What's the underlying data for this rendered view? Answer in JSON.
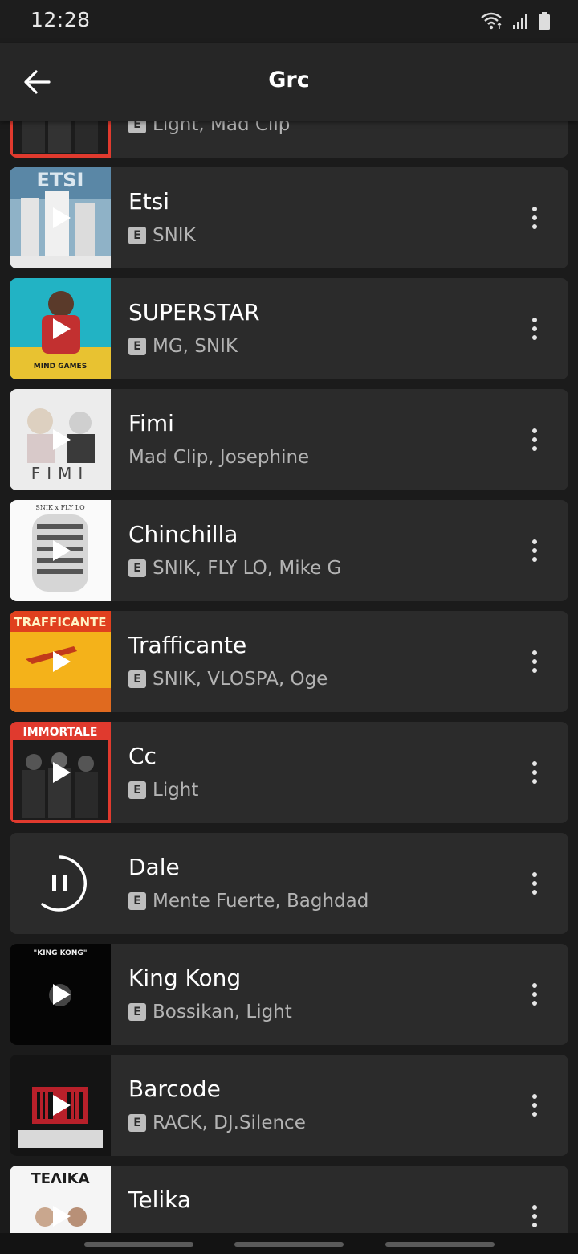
{
  "status_bar": {
    "time": "12:28",
    "icons": [
      "wifi-icon",
      "signal-icon",
      "battery-icon"
    ]
  },
  "header": {
    "title": "Grc",
    "back_icon": "arrow-left-icon"
  },
  "tracks": [
    {
      "title": "",
      "artists": "Light, Mad Clip",
      "explicit": true,
      "art": "immortale",
      "state": "play"
    },
    {
      "title": "Etsi",
      "artists": "SNIK",
      "explicit": true,
      "art": "etsi",
      "state": "play"
    },
    {
      "title": "SUPERSTAR",
      "artists": "MG, SNIK",
      "explicit": true,
      "art": "superstar",
      "state": "play"
    },
    {
      "title": "Fimi",
      "artists": "Mad Clip, Josephine",
      "explicit": false,
      "art": "fimi",
      "state": "play"
    },
    {
      "title": "Chinchilla",
      "artists": "SNIK, FLY LO, Mike G",
      "explicit": true,
      "art": "chinchilla",
      "state": "play"
    },
    {
      "title": "Trafficante",
      "artists": "SNIK, VLOSPA, Oge",
      "explicit": true,
      "art": "trafficante",
      "state": "play"
    },
    {
      "title": "Cc",
      "artists": "Light",
      "explicit": true,
      "art": "immortale",
      "state": "play"
    },
    {
      "title": "Dale",
      "artists": "Mente Fuerte, Baghdad",
      "explicit": true,
      "art": "none",
      "state": "pause"
    },
    {
      "title": "King Kong",
      "artists": "Bossikan, Light",
      "explicit": true,
      "art": "kingkong",
      "state": "play"
    },
    {
      "title": "Barcode",
      "artists": "RACK, DJ.Silence",
      "explicit": true,
      "art": "barcode",
      "state": "play"
    },
    {
      "title": "Telika",
      "artists": "",
      "explicit": false,
      "art": "telika",
      "state": "play"
    }
  ],
  "album_art_text": {
    "etsi": "ETSI",
    "superstar": "MIND GAMES",
    "fimi": "FIMI",
    "chinchilla": "SNIK x FLY LO",
    "trafficante": "TRAFFICANTE",
    "immortale": "IMMORTALE",
    "kingkong": "\"KING KONG\"",
    "telika": "ΤΕΛΙΚΑ"
  },
  "colors": {
    "background": "#1b1b1b",
    "card": "#2b2b2b",
    "app_bar": "#262626",
    "secondary_text": "#b3b3b3",
    "accent_red": "#e03a2e"
  }
}
